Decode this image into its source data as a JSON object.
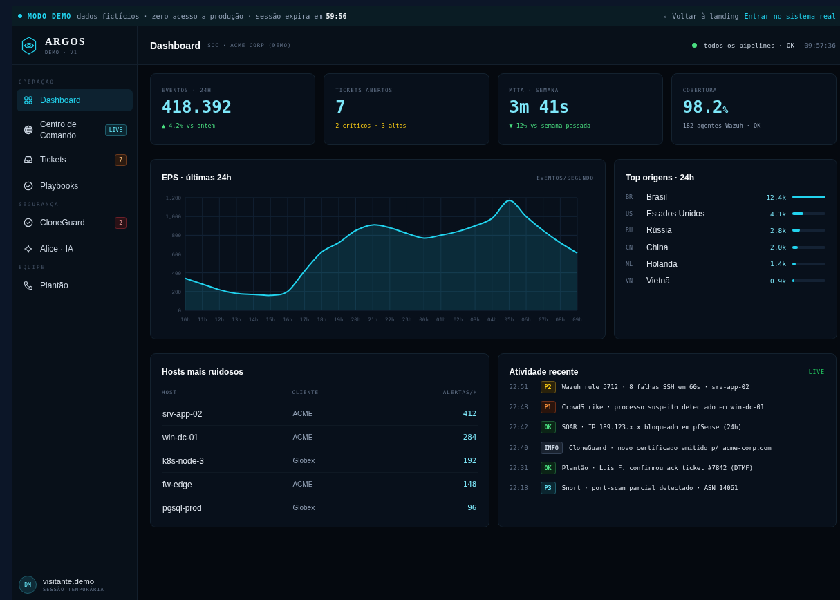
{
  "demo_banner": {
    "label": "MODO DEMO",
    "message": "dados fictícios · zero acesso a produção · sessão expira em",
    "timer": "59:56",
    "back_link": "← Voltar à landing",
    "enter_link": "Entrar no sistema real"
  },
  "sidebar": {
    "brand": "ARGOS",
    "version": "DEMO · V1",
    "sections": [
      {
        "title": "OPERAÇÃO",
        "items": [
          {
            "label": "Dashboard",
            "selected": true
          },
          {
            "label": "Centro de Comando",
            "selected": false,
            "badge": {
              "text": "LIVE",
              "kind": "live"
            }
          },
          {
            "label": "Tickets",
            "selected": false,
            "badge": {
              "text": "7",
              "kind": "warn"
            }
          },
          {
            "label": "Playbooks",
            "selected": false
          }
        ]
      },
      {
        "title": "SEGURANÇA",
        "items": [
          {
            "label": "CloneGuard",
            "selected": false,
            "badge": {
              "text": "2",
              "kind": "danger"
            }
          },
          {
            "label": "Alice · IA",
            "selected": false
          }
        ]
      },
      {
        "title": "EQUIPE",
        "items": [
          {
            "label": "Plantão",
            "selected": false
          }
        ]
      }
    ],
    "user": {
      "initials": "DM",
      "name": "visitante.demo",
      "role": "SESSÃO TEMPORÁRIA"
    }
  },
  "header": {
    "title": "Dashboard",
    "subtitle": "SOC · ACME CORP (DEMO)",
    "status": "todos os pipelines · OK",
    "time": "09:57:36"
  },
  "kpis": [
    {
      "label": "EVENTOS · 24H",
      "value": "418.392",
      "delta": "▲ 4.2% vs ontem",
      "kind": "up"
    },
    {
      "label": "TICKETS ABERTOS",
      "value": "7",
      "delta": "2 críticos · 3 altos",
      "kind": "warn"
    },
    {
      "label": "MTTA · SEMANA",
      "value": "3m 41s",
      "delta": "▼ 12% vs semana passada",
      "kind": "up"
    },
    {
      "label": "COBERTURA",
      "value": "98.2",
      "unit": "%",
      "delta": "182 agentes Wazuh · OK",
      "kind": "neutral"
    }
  ],
  "eps_panel": {
    "title": "EPS · últimas 24h",
    "unit_label": "EVENTOS/SEGUNDO",
    "chart_data": {
      "type": "area",
      "categories": [
        "10h",
        "11h",
        "12h",
        "13h",
        "14h",
        "15h",
        "16h",
        "17h",
        "18h",
        "19h",
        "20h",
        "21h",
        "22h",
        "23h",
        "00h",
        "01h",
        "02h",
        "03h",
        "04h",
        "05h",
        "06h",
        "07h",
        "08h",
        "09h"
      ],
      "grid": true,
      "series": [
        {
          "color": "#22d3ee",
          "values": [
            340,
            280,
            220,
            180,
            170,
            160,
            200,
            420,
            620,
            720,
            850,
            910,
            880,
            820,
            770,
            800,
            840,
            900,
            980,
            1170,
            1000,
            850,
            720,
            610
          ]
        }
      ],
      "ylim": [
        0,
        1200
      ],
      "yticks": [
        {
          "value": 0,
          "label": "0"
        },
        {
          "value": 200,
          "label": "200"
        },
        {
          "value": 400,
          "label": "400"
        },
        {
          "value": 600,
          "label": "600"
        },
        {
          "value": 800,
          "label": "800"
        },
        {
          "value": 1000,
          "label": "1,000"
        },
        {
          "value": 1200,
          "label": "1,200"
        }
      ]
    }
  },
  "origins_panel": {
    "title": "Top origens · 24h",
    "rows": [
      {
        "code": "BR",
        "country": "Brasil",
        "count": "12.4k",
        "level": 1.0
      },
      {
        "code": "US",
        "country": "Estados Unidos",
        "count": "4.1k",
        "level": 0.33
      },
      {
        "code": "RU",
        "country": "Rússia",
        "count": "2.8k",
        "level": 0.23
      },
      {
        "code": "CN",
        "country": "China",
        "count": "2.0k",
        "level": 0.16
      },
      {
        "code": "NL",
        "country": "Holanda",
        "count": "1.4k",
        "level": 0.11
      },
      {
        "code": "VN",
        "country": "Vietnã",
        "count": "0.9k",
        "level": 0.07
      }
    ]
  },
  "hosts_panel": {
    "title": "Hosts mais ruidosos",
    "columns": [
      "HOST",
      "CLIENTE",
      "ALERTAS/H"
    ],
    "rows": [
      [
        "srv-app-02",
        "ACME",
        "412"
      ],
      [
        "win-dc-01",
        "ACME",
        "284"
      ],
      [
        "k8s-node-3",
        "Globex",
        "192"
      ],
      [
        "fw-edge",
        "ACME",
        "148"
      ],
      [
        "pgsql-prod",
        "Globex",
        "96"
      ]
    ]
  },
  "activity_panel": {
    "title": "Atividade recente",
    "live_label": "LIVE",
    "events": [
      {
        "time": "22:51",
        "tag": "P2",
        "kind": "p2",
        "text": "Wazuh rule 5712 · 8 falhas SSH em 60s · srv-app-02"
      },
      {
        "time": "22:48",
        "tag": "P1",
        "kind": "p1",
        "text": "CrowdStrike · processo suspeito detectado em win-dc-01"
      },
      {
        "time": "22:42",
        "tag": "OK",
        "kind": "ok",
        "text": "SOAR · IP 189.123.x.x bloqueado em pfSense (24h)"
      },
      {
        "time": "22:40",
        "tag": "INFO",
        "kind": "info",
        "text": "CloneGuard · novo certificado emitido p/ acme-corp.com"
      },
      {
        "time": "22:31",
        "tag": "OK",
        "kind": "ok",
        "text": "Plantão · Luis F. confirmou ack ticket #7842 (DTMF)"
      },
      {
        "time": "22:18",
        "tag": "P3",
        "kind": "p3",
        "text": "Snort · port-scan parcial detectado · ASN 14061"
      }
    ]
  }
}
